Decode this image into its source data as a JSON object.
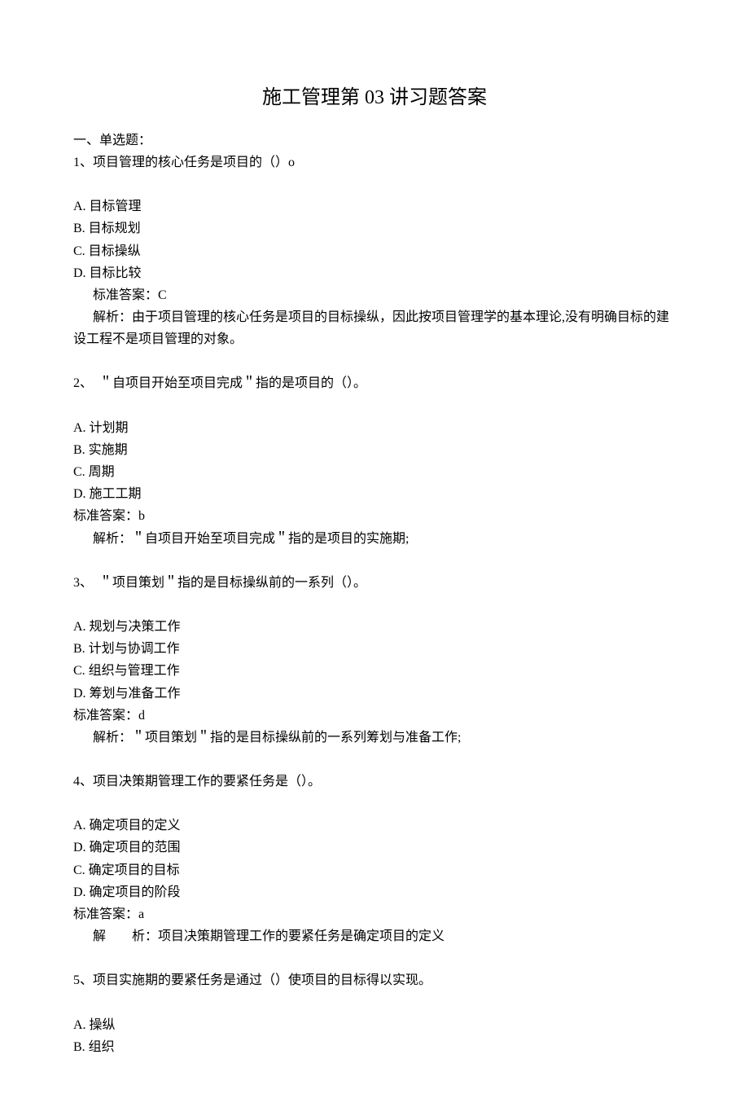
{
  "title": "施工管理第 03 讲习题答案",
  "section_heading": "一、单选题：",
  "questions": [
    {
      "stem": "1、项目管理的核心任务是项目的（）o",
      "options": [
        "A. 目标管理",
        "B. 目标规划",
        "C. 目标操纵",
        "D. 目标比较"
      ],
      "answer": "标准答案：C",
      "answer_indent": true,
      "explain_lines": [
        "解析：由于项目管理的核心任务是项目的目标操纵，因此按项目管理学的基本理论,没有明确目标的建设工程不是项目管理的对象。"
      ],
      "explain_style": "hanging"
    },
    {
      "stem": "2、　＂自项目开始至项目完成＂指的是项目的（）。",
      "options": [
        "A. 计划期",
        "B. 实施期",
        "C. 周期",
        "D. 施工工期"
      ],
      "answer": "标准答案：b",
      "answer_indent": false,
      "explain_lines": [
        "解析：＂自项目开始至项目完成＂指的是项目的实施期;"
      ],
      "explain_style": "indent"
    },
    {
      "stem": "3、　＂项目策划＂指的是目标操纵前的一系列（）。",
      "options": [
        "A. 规划与决策工作",
        "B. 计划与协调工作",
        "C. 组织与管理工作",
        "D. 筹划与准备工作"
      ],
      "answer": "标准答案：d",
      "answer_indent": false,
      "explain_lines": [
        "解析：＂项目策划＂指的是目标操纵前的一系列筹划与准备工作;"
      ],
      "explain_style": "indent"
    },
    {
      "stem": "4、项目决策期管理工作的要紧任务是（）。",
      "options": [
        "A. 确定项目的定义",
        "D. 确定项目的范围",
        "C. 确定项目的目标",
        "D. 确定项目的阶段"
      ],
      "answer": "标准答案：a",
      "answer_indent": false,
      "explain_lines": [
        "解　　析：项目决策期管理工作的要紧任务是确定项目的定义"
      ],
      "explain_style": "indent"
    },
    {
      "stem": "5、项目实施期的要紧任务是通过（）使项目的目标得以实现。",
      "options": [
        "A. 操纵",
        "B. 组织"
      ],
      "answer": null,
      "answer_indent": false,
      "explain_lines": [],
      "explain_style": "none"
    }
  ]
}
